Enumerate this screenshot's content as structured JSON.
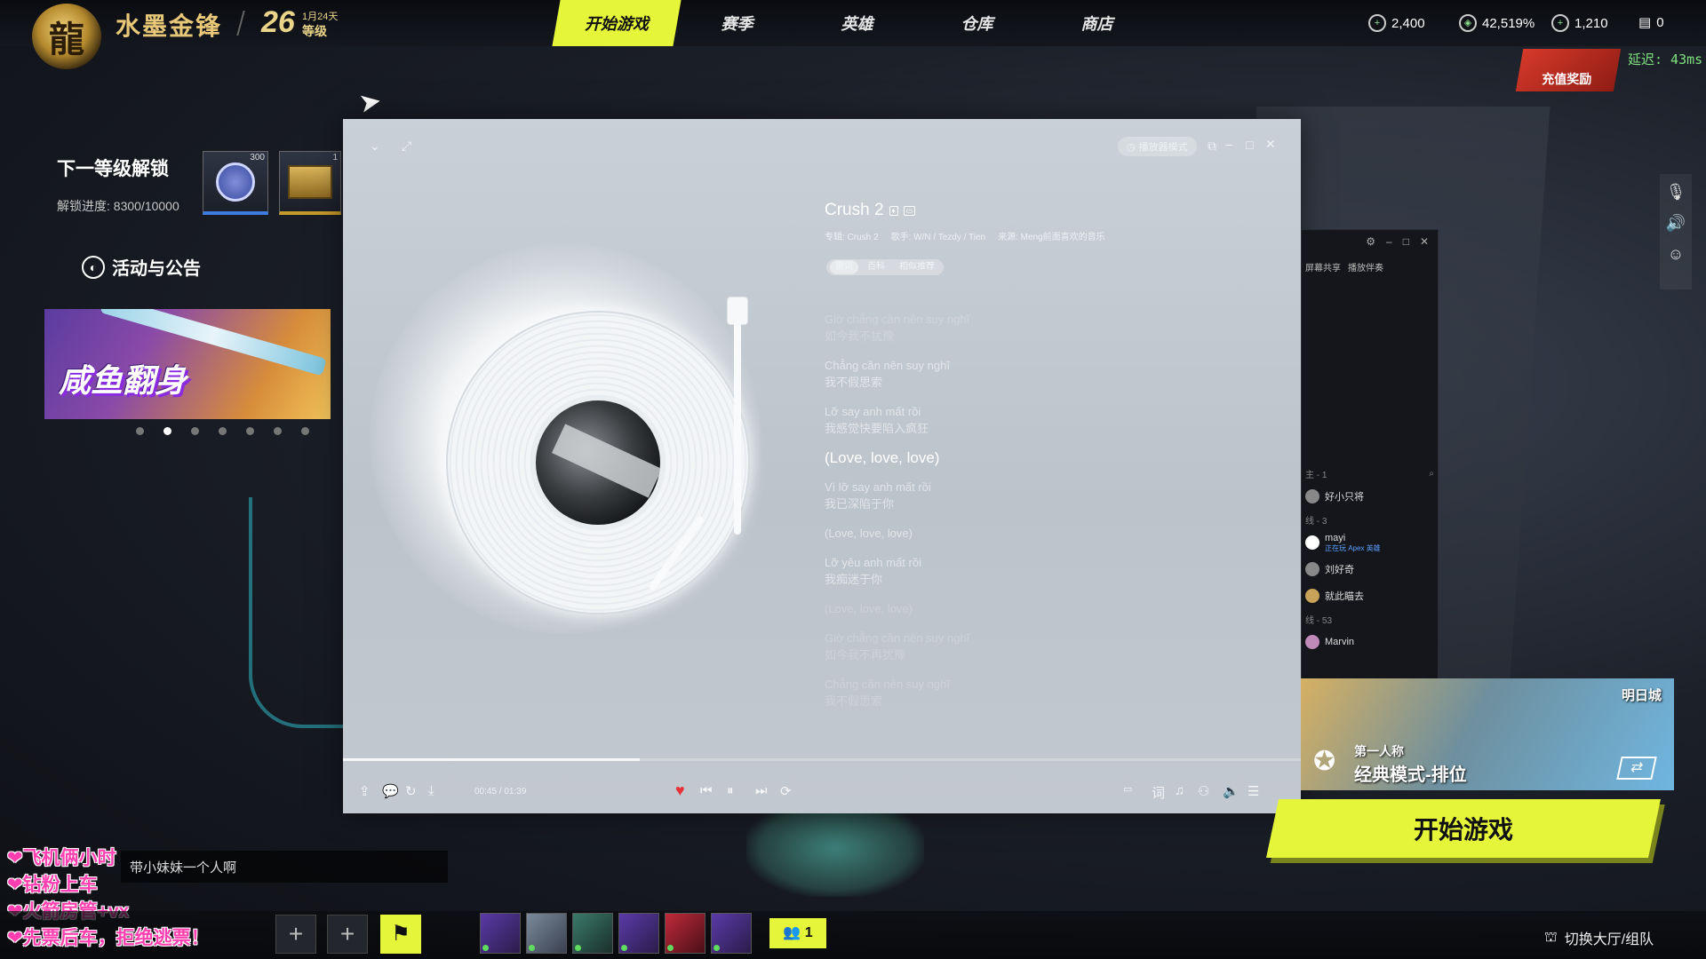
{
  "game": {
    "title": "水墨金锋",
    "level_number": "26",
    "level_date": "1月24天",
    "level_label": "等级"
  },
  "nav": {
    "items": [
      "开始游戏",
      "赛季",
      "英雄",
      "仓库",
      "商店"
    ],
    "active_index": 0
  },
  "currencies": [
    {
      "icon": "green-gem-icon",
      "value": "2,400"
    },
    {
      "icon": "shield-coin-icon",
      "value": "42,519%"
    },
    {
      "icon": "ticket-icon",
      "value": "1,210"
    },
    {
      "icon": "card-icon",
      "value": "0"
    }
  ],
  "recharge_label": "充值奖励",
  "latency": "延迟: 43ms",
  "unlock": {
    "title": "下一等级解锁",
    "progress": "解锁进度: 8300/10000",
    "rewards": [
      {
        "icon": "coin-icon",
        "count": "300"
      },
      {
        "icon": "supply-box-icon",
        "count": "1"
      }
    ]
  },
  "activity": {
    "title": "活动与公告",
    "banner_text": "咸鱼翻身",
    "dots_count": 7,
    "active_dot": 1
  },
  "player": {
    "mode_label": "播放器模式",
    "song_title": "Crush 2",
    "album": "专辑: Crush 2",
    "artist": "歌手: W/N / Tezdy / Tien",
    "source": "来源: Meng前面喜欢的音乐",
    "tabs": [
      "歌词",
      "百科",
      "相似推荐"
    ],
    "active_tab": 0,
    "lyrics": [
      {
        "a": "Giờ chẳng cần nên suy nghĩ",
        "b": "如今我不犹豫",
        "state": "dim"
      },
      {
        "a": "Chẳng cần nên suy nghĩ",
        "b": "我不假思索",
        "state": "normal"
      },
      {
        "a": "Lỡ say anh mất rồi",
        "b": "我感觉快要陷入疯狂",
        "state": "normal"
      },
      {
        "a": "(Love, love, love)",
        "b": "",
        "state": "current"
      },
      {
        "a": "Vì lỡ say anh mất rồi",
        "b": "我已深陷于你",
        "state": "normal"
      },
      {
        "a": "(Love, love, love)",
        "b": "",
        "state": "normal"
      },
      {
        "a": "Lỡ yêu anh mất rồi",
        "b": "我痴迷于你",
        "state": "normal"
      },
      {
        "a": "(Love, love, love)",
        "b": "",
        "state": "dim"
      },
      {
        "a": "Giờ chẳng cần nên suy nghĩ",
        "b": "如今我不再犹豫",
        "state": "dim"
      },
      {
        "a": "Chẳng cần nên suy nghĩ",
        "b": "我不假思索",
        "state": "dim"
      }
    ],
    "time": "00:45 / 01:39",
    "progress_fraction": 0.31
  },
  "chat_window": {
    "buttons": [
      "屏幕共享",
      "播放伴奏"
    ],
    "section1": "主 - 1",
    "users1": [
      {
        "name": "好小只将",
        "sub": ""
      }
    ],
    "section2": "线 - 3",
    "users2": [
      {
        "name": "mayi",
        "sub": "正在玩 Apex 英雄"
      },
      {
        "name": "刘好奇",
        "sub": ""
      },
      {
        "name": "就此瞄去",
        "sub": ""
      }
    ],
    "section3": "线 - 53",
    "users3": [
      {
        "name": "Marvin",
        "sub": ""
      }
    ]
  },
  "map": {
    "name": "明日城",
    "mode_small": "第一人称",
    "mode_big": "经典模式-排位"
  },
  "start_button": "开始游戏",
  "chat_message": "带小妹妹一个人啊",
  "stream_overlay": [
    "❤飞机俩小时",
    "❤钻粉上车",
    "❤火箭房管+vx",
    "❤先票后车，拒绝逃票！"
  ],
  "party_count": "1",
  "switch_hall": "切换大厅/组队",
  "colors": {
    "accent": "#e5f53a",
    "latency": "#7fe07f",
    "stream_text": "#ff3fb0"
  }
}
